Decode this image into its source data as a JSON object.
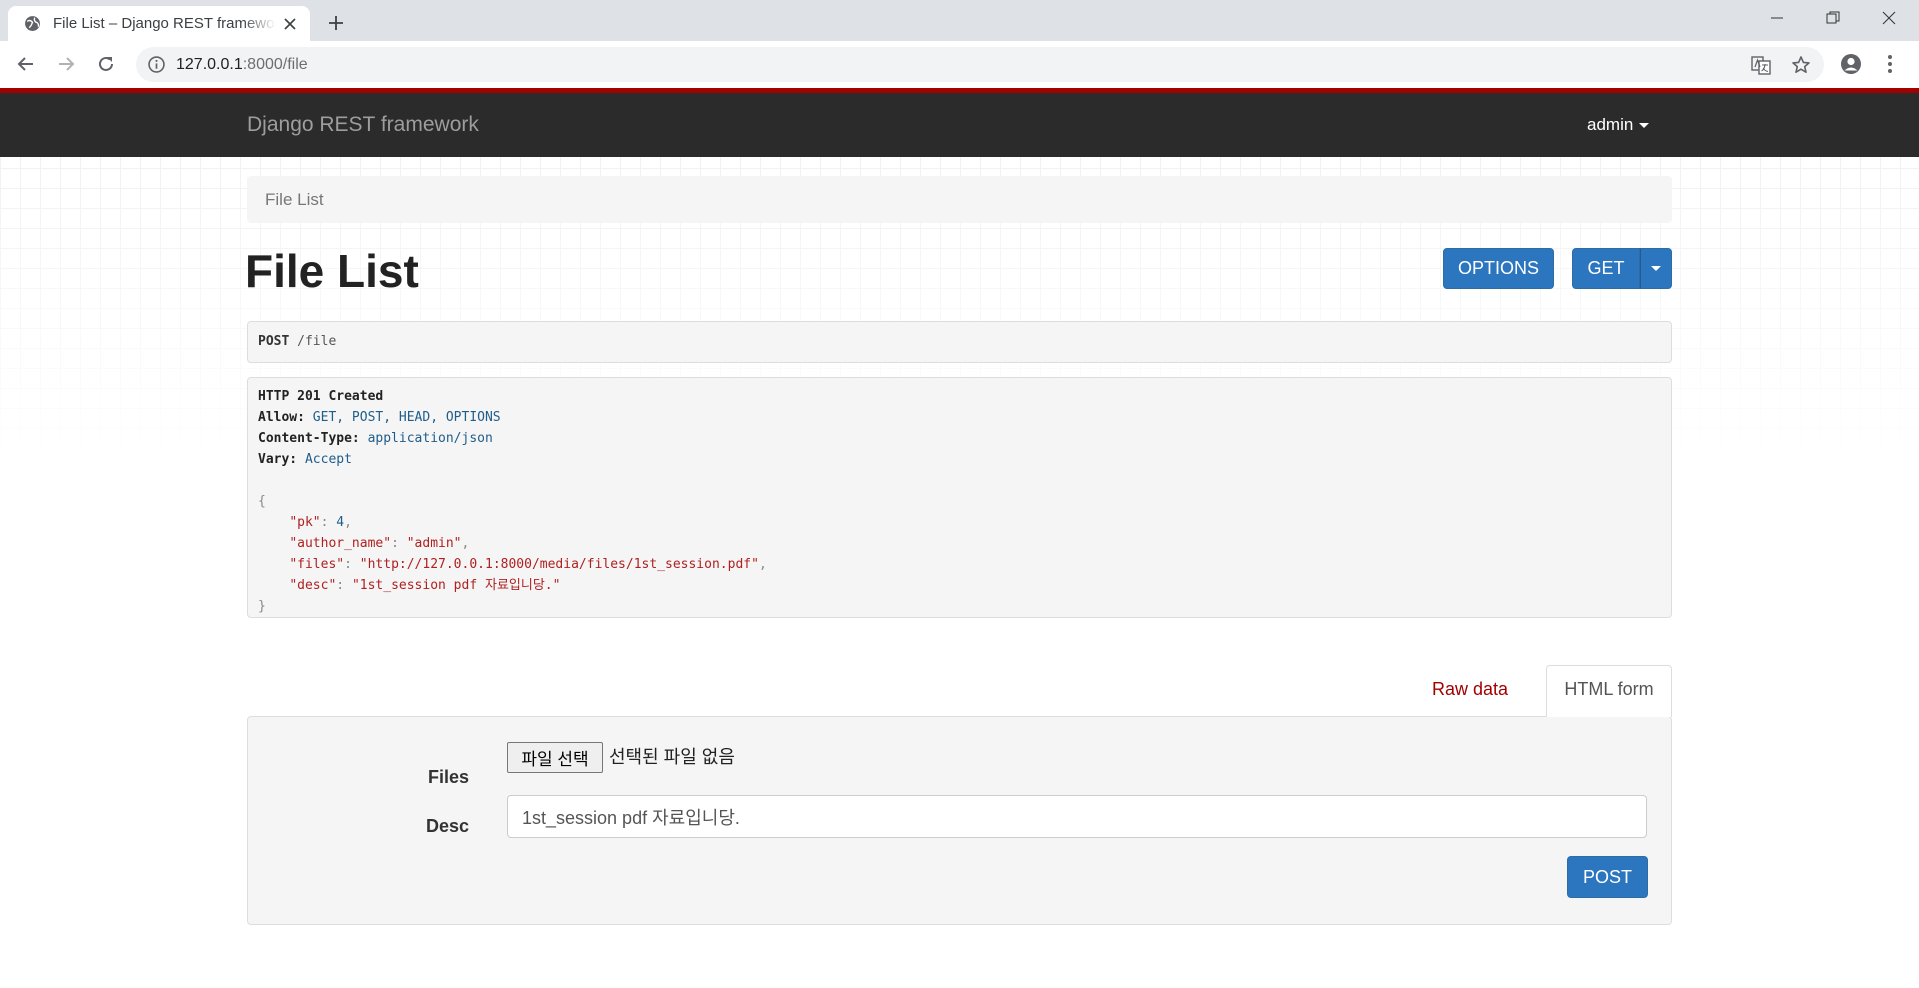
{
  "browser": {
    "tab_title": "File List – Django REST framework",
    "url_host": "127.0.0.1",
    "url_path": ":8000/file"
  },
  "navbar": {
    "brand": "Django REST framework",
    "user": "admin"
  },
  "breadcrumb": {
    "current": "File List"
  },
  "main": {
    "title": "File List",
    "options_label": "OPTIONS",
    "get_label": "GET"
  },
  "request": {
    "method": "POST",
    "path": "/file"
  },
  "response": {
    "status": "HTTP 201 Created",
    "headers": [
      {
        "key": "Allow:",
        "value": "GET, POST, HEAD, OPTIONS"
      },
      {
        "key": "Content-Type:",
        "value": "application/json"
      },
      {
        "key": "Vary:",
        "value": "Accept"
      }
    ],
    "body": {
      "pk_key": "\"pk\"",
      "pk_value": "4",
      "author_key": "\"author_name\"",
      "author_value": "\"admin\"",
      "files_key": "\"files\"",
      "files_value": "\"http://127.0.0.1:8000/media/files/1st_session.pdf\"",
      "desc_key": "\"desc\"",
      "desc_value": "\"1st_session pdf 자료입니당.\""
    }
  },
  "form": {
    "tab_raw": "Raw data",
    "tab_html": "HTML form",
    "files_label": "Files",
    "file_button": "파일 선택",
    "file_status": "선택된 파일 없음",
    "desc_label": "Desc",
    "desc_value": "1st_session pdf 자료입니당.",
    "submit_label": "POST"
  },
  "colors": {
    "navbar_bg": "#2b2b2b",
    "accent_red": "#a30000",
    "primary_button": "#2c76c0"
  }
}
